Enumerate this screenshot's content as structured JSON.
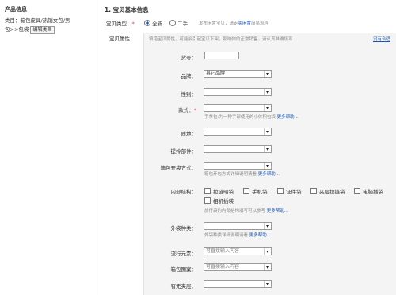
{
  "left": {
    "title": "产品信息",
    "category_line1": "类目：箱包皮具/热销女包/男",
    "category_line2": "包>>包袋",
    "edit_button": "编辑类目"
  },
  "main": {
    "section_title": "1. 宝贝基本信息",
    "type_label": "宝贝类型：",
    "type_new": "全新",
    "type_used": "二手",
    "type_hint_pre": "发布闲置宝贝，请走",
    "type_hint_link": "卖闲置",
    "type_hint_post": "简易流程",
    "attr_label": "宝贝属性：",
    "attr_notice": "填错宝贝属性，可能会引起宝贝下架，影响你的正常销售。请认真准确填写",
    "attr_notice_link": "没有合适"
  },
  "fields": {
    "huohao": {
      "label": "货号："
    },
    "pinpai": {
      "label": "品牌：",
      "value": "其它品牌"
    },
    "xingbie": {
      "label": "性别："
    },
    "kuanshi": {
      "label": "款式：",
      "hint": "手拿包:为一种手部使用的小体积包袋",
      "help": "更多帮助..."
    },
    "zhidi": {
      "label": "质地："
    },
    "tima": {
      "label": "提拎部件："
    },
    "kaidai": {
      "label": "箱包开袋方式：",
      "hint": "箱包开包方式详细说明请看",
      "help": "更多帮助..."
    },
    "neibu": {
      "label": "内部结构：",
      "options": [
        "拉链暗袋",
        "手机袋",
        "证件袋",
        "夹层拉链袋",
        "电脑插袋",
        "相机插袋"
      ],
      "hint": "旅行袋的内部结构填写可以参考",
      "help": "更多帮助..."
    },
    "waidai": {
      "label": "外袋种类：",
      "hint": "外袋种类详细说明请看",
      "help": "更多帮助..."
    },
    "liuxing": {
      "label": "流行元素：",
      "value": "可直接输入内容"
    },
    "tuan": {
      "label": "箱包图案：",
      "value": "可直接输入内容"
    },
    "jiaceng": {
      "label": "有无夹层："
    }
  },
  "colors": {
    "accent": "#1a56b0",
    "required": "#e4393c",
    "panel": "#f4f4f4"
  }
}
